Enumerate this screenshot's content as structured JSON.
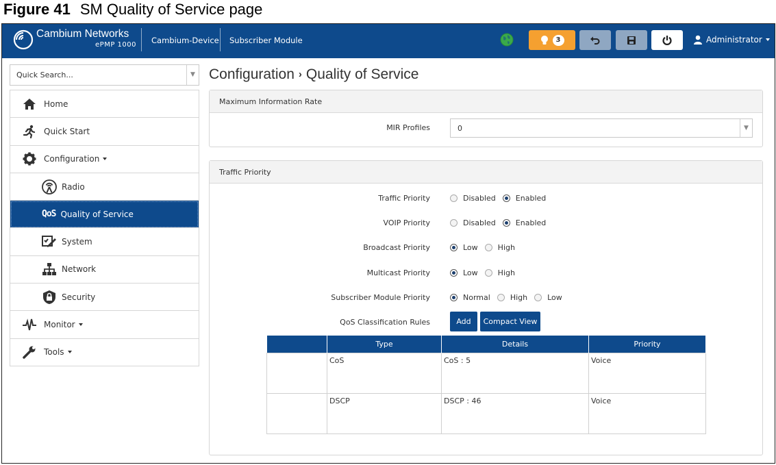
{
  "caption": {
    "figure": "Figure 41",
    "title": "SM Quality of Service page"
  },
  "topbar": {
    "brand_name": "Cambium Networks",
    "brand_model": "ePMP 1000",
    "device_name": "Cambium-Device",
    "device_mode": "Subscriber Module",
    "alert_count": "3",
    "user": "Administrator"
  },
  "sidebar": {
    "search_placeholder": "Quick Search...",
    "items": [
      {
        "label": "Home"
      },
      {
        "label": "Quick Start"
      },
      {
        "label": "Configuration"
      },
      {
        "label": "Radio"
      },
      {
        "label": "Quality of Service",
        "icon_text": "QoS"
      },
      {
        "label": "System"
      },
      {
        "label": "Network"
      },
      {
        "label": "Security"
      },
      {
        "label": "Monitor"
      },
      {
        "label": "Tools"
      }
    ]
  },
  "breadcrumb": {
    "section": "Configuration",
    "page": "Quality of Service"
  },
  "mir_panel": {
    "title": "Maximum Information Rate",
    "mir_profiles_label": "MIR Profiles",
    "mir_profiles_value": "0"
  },
  "traffic_panel": {
    "title": "Traffic Priority",
    "traffic_priority": {
      "label": "Traffic Priority",
      "options": [
        "Disabled",
        "Enabled"
      ],
      "selected": "Enabled"
    },
    "voip_priority": {
      "label": "VOIP Priority",
      "options": [
        "Disabled",
        "Enabled"
      ],
      "selected": "Enabled"
    },
    "broadcast_priority": {
      "label": "Broadcast Priority",
      "options": [
        "Low",
        "High"
      ],
      "selected": "Low"
    },
    "multicast_priority": {
      "label": "Multicast Priority",
      "options": [
        "Low",
        "High"
      ],
      "selected": "Low"
    },
    "sm_priority": {
      "label": "Subscriber Module Priority",
      "options": [
        "Normal",
        "High",
        "Low"
      ],
      "selected": "Normal"
    },
    "qos_rules_label": "QoS Classification Rules",
    "add_label": "Add",
    "compact_view_label": "Compact View",
    "table": {
      "headers": [
        "",
        "Type",
        "Details",
        "Priority"
      ],
      "rows": [
        {
          "type": "CoS",
          "details": "CoS : 5",
          "priority": "Voice"
        },
        {
          "type": "DSCP",
          "details": "DSCP : 46",
          "priority": "Voice"
        }
      ]
    }
  },
  "colors": {
    "brand_blue": "#0e4a8c",
    "alert_orange": "#f5a030",
    "globe_green": "#3aaa4a"
  }
}
